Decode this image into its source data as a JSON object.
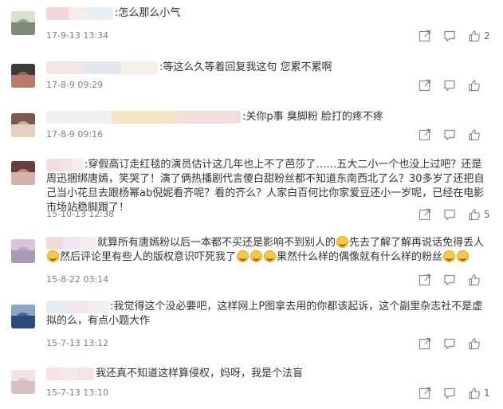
{
  "comments": [
    {
      "name": "",
      "text_parts": [
        {
          "t": ":怎么那么小气"
        }
      ],
      "date": "17-9-13 13:34",
      "likes": "2"
    },
    {
      "name": "",
      "text_parts": [
        {
          "t": ":等这么久等着回复我这句 您累不累啊"
        }
      ],
      "date": "17-8-9 09:29",
      "likes": ""
    },
    {
      "name": "",
      "text_parts": [
        {
          "t": ":关你p事 臭脚粉 脸打的疼不疼"
        }
      ],
      "date": "17-8-9 09:16",
      "likes": ""
    },
    {
      "name": "",
      "text_parts": [
        {
          "t": ":穿假高订走红毯的演员估计这几年也上不了芭莎了……五大二小一个也没上过吧？还是周迅捆绑唐嫣，笑哭了！演了俩热播剧代言傻白甜粉丝都不知道东南西北了么？30多岁了还把自己当小花旦去跟杨幂ab倪妮看齐呢？看的齐么？人家白百何比你家爱豆还小一岁呢，已经在电影市场站稳脚跟了！"
        }
      ],
      "date": "15-10-13 12:38",
      "likes": "5"
    },
    {
      "name": "",
      "text_parts": [
        {
          "t": "就算所有唐嫣粉以后一本都不买还是影响不到别人的"
        },
        {
          "emoji": "grin"
        },
        {
          "t": "先去了解了解再说话免得丢人"
        },
        {
          "emoji": "grin"
        },
        {
          "t": "然后评论里有些人的版权意识吓死我了"
        },
        {
          "emoji": "grin"
        },
        {
          "emoji": "grin"
        },
        {
          "emoji": "grin"
        },
        {
          "t": "果然什么样的偶像就有什么样的粉丝"
        },
        {
          "emoji": "grin"
        },
        {
          "emoji": "grin"
        }
      ],
      "date": "15-8-22 03:14",
      "likes": ""
    },
    {
      "name": "",
      "text_parts": [
        {
          "t": ":我觉得这个没必要吧，这样网上P图拿去用的你都该起诉，这个副里杂志社不是虚拟的么，有点小题大作"
        }
      ],
      "date": "15-7-13 13:12",
      "likes": ""
    },
    {
      "name": "",
      "text_parts": [
        {
          "t": "我还真不知道这样算侵权，妈呀，我是个法盲"
        }
      ],
      "date": "15-7-13 13:10",
      "likes": "1"
    }
  ],
  "icons": {
    "share": "share-icon",
    "comment": "comment-icon",
    "like": "thumbs-up-icon"
  },
  "colors": {
    "text": "#333333",
    "date": "#808080",
    "icon": "#8a8a8a",
    "emoji": "#f6c94a"
  }
}
